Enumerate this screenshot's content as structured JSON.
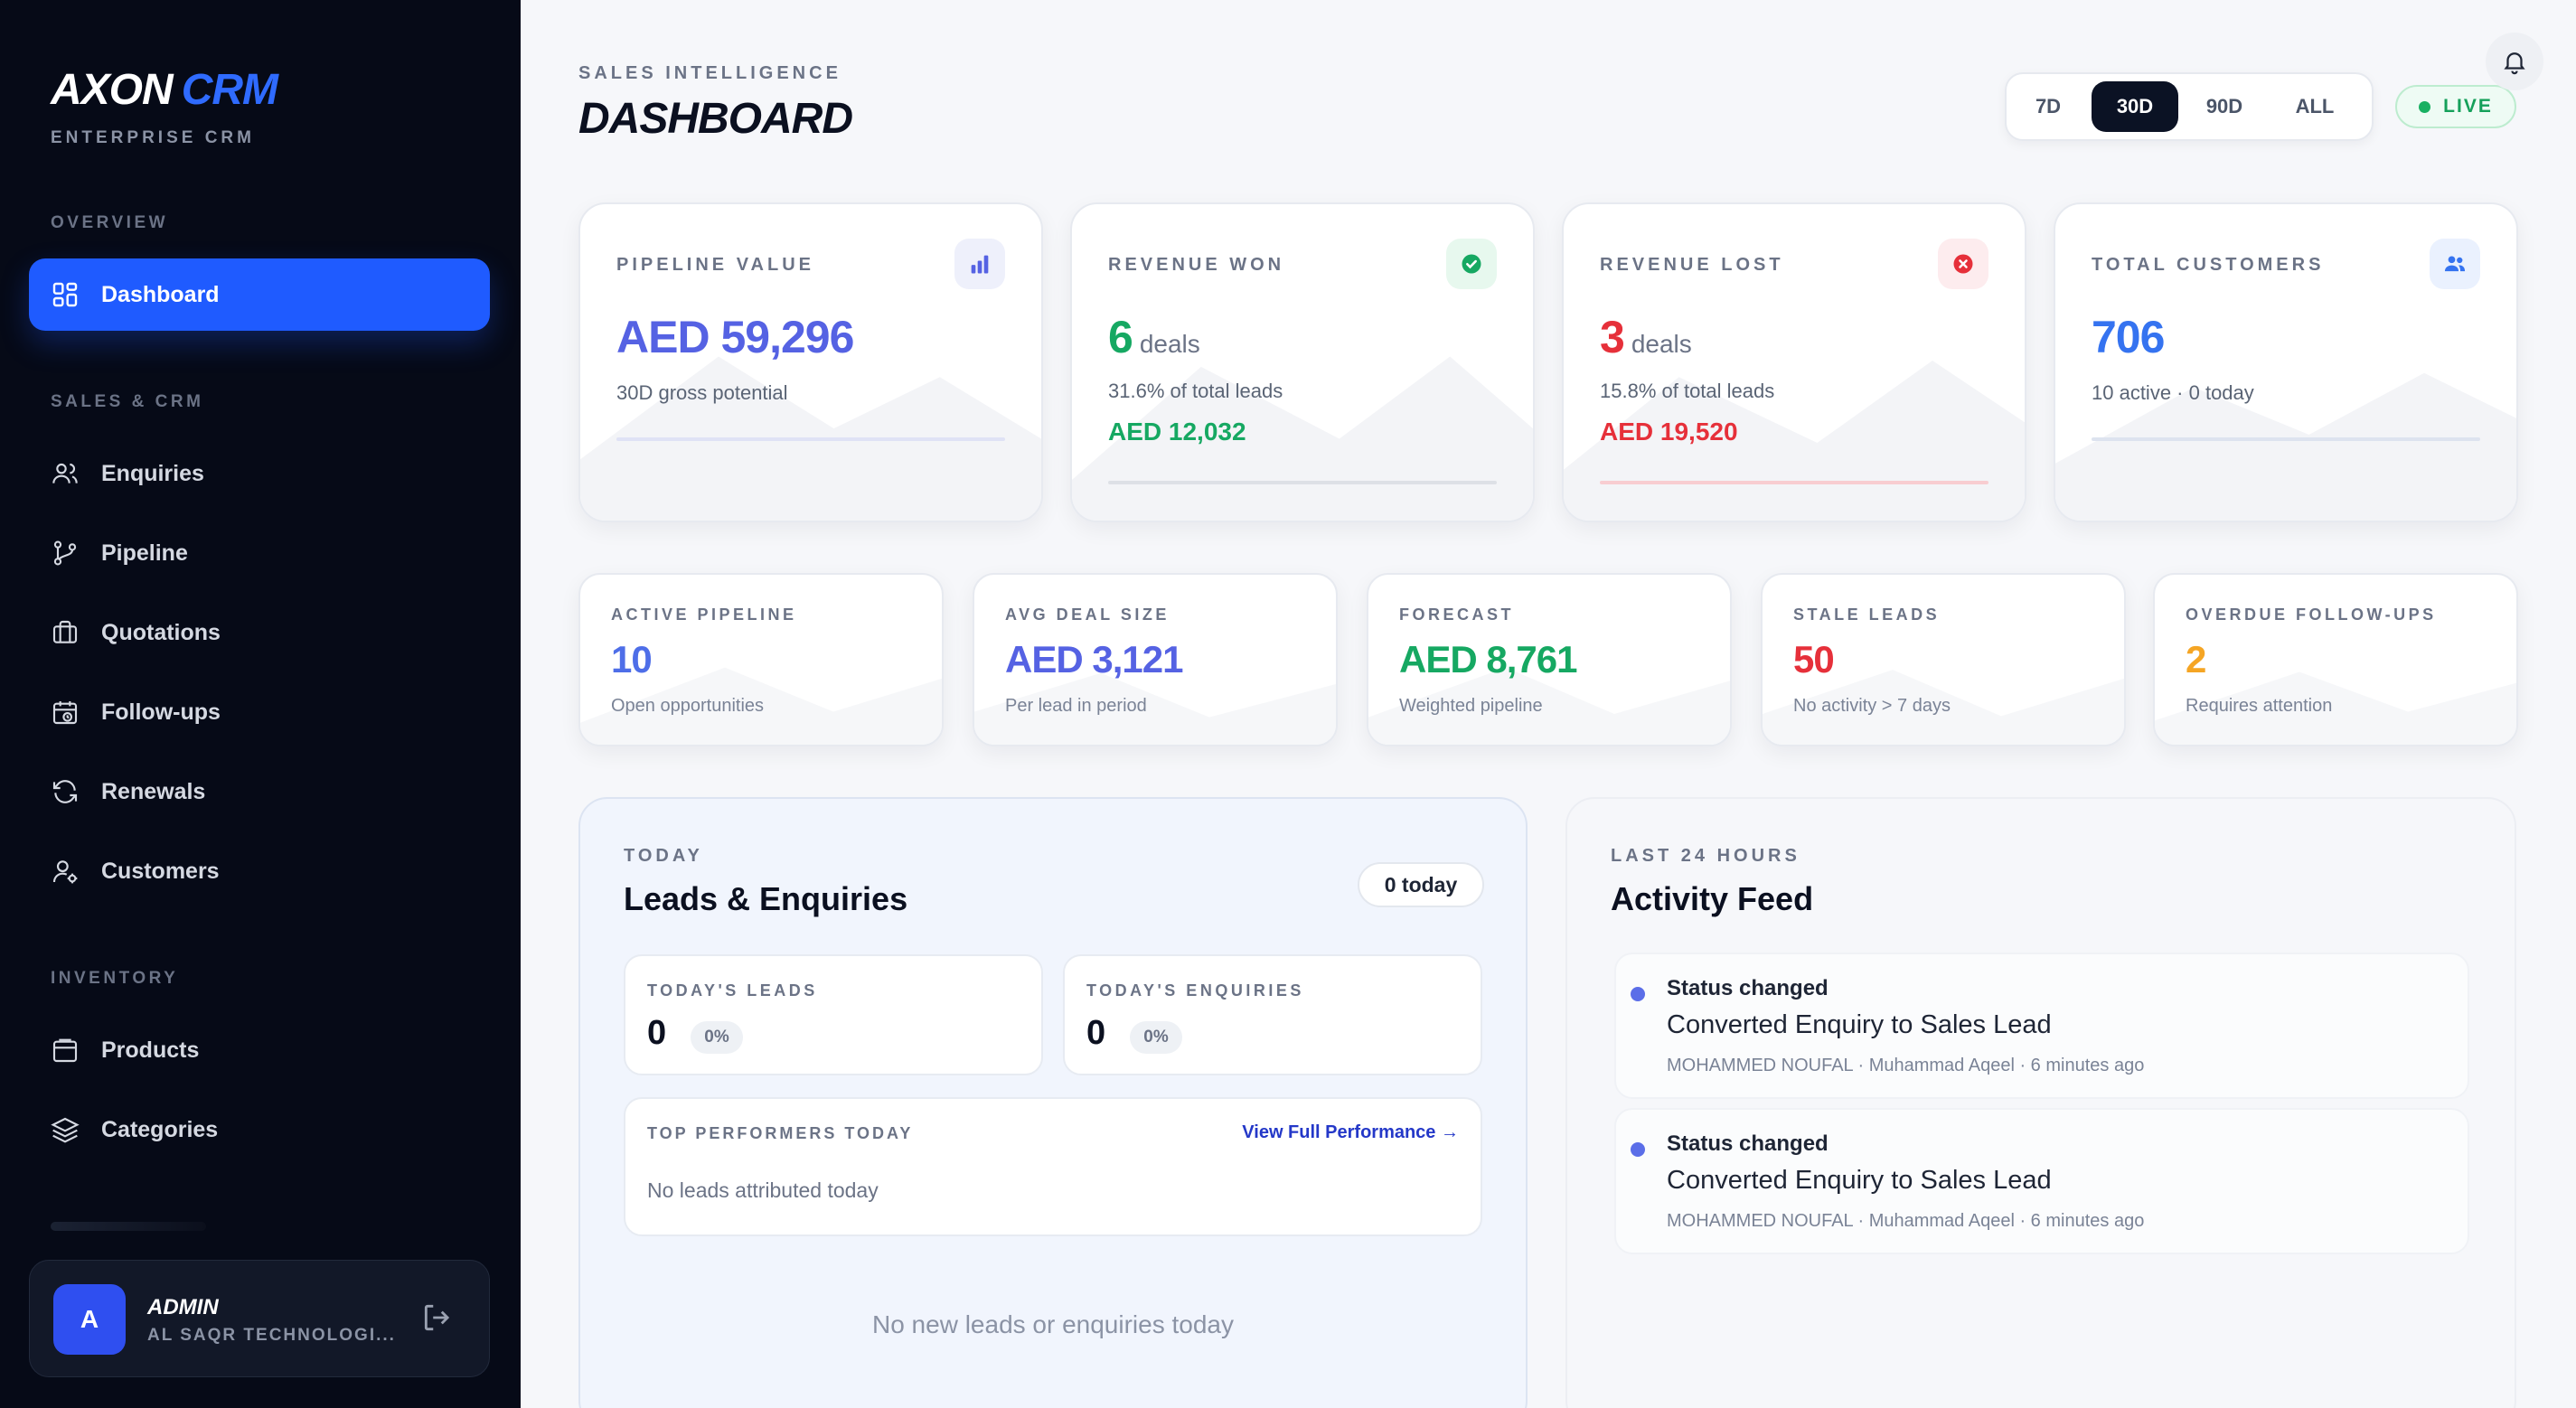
{
  "brand": {
    "name": "AXON",
    "accent": "CRM",
    "subtitle": "ENTERPRISE CRM"
  },
  "sidebar": {
    "sections": {
      "overview": "OVERVIEW",
      "sales": "SALES & CRM",
      "inventory": "INVENTORY"
    },
    "items": [
      {
        "label": "Dashboard",
        "icon": "dashboard-icon",
        "active": true
      },
      {
        "label": "Enquiries",
        "icon": "users-icon"
      },
      {
        "label": "Pipeline",
        "icon": "branch-icon"
      },
      {
        "label": "Quotations",
        "icon": "briefcase-icon"
      },
      {
        "label": "Follow-ups",
        "icon": "calendar-clock-icon"
      },
      {
        "label": "Renewals",
        "icon": "refresh-icon"
      },
      {
        "label": "Customers",
        "icon": "user-gear-icon"
      },
      {
        "label": "Products",
        "icon": "box-icon"
      },
      {
        "label": "Categories",
        "icon": "layers-icon"
      }
    ],
    "user": {
      "initial": "A",
      "name": "ADMIN",
      "org": "AL SAQR TECHNOLOGI..."
    }
  },
  "header": {
    "eyebrow": "SALES INTELLIGENCE",
    "title": "DASHBOARD",
    "ranges": [
      "7D",
      "30D",
      "90D",
      "ALL"
    ],
    "selected_range": "30D",
    "live_label": "LIVE"
  },
  "colors": {
    "accent": "#1f5bff",
    "purple": "#5562e3",
    "green": "#16a862",
    "red": "#e6303a",
    "blue": "#3573f0",
    "orange": "#f5a524",
    "sidebar_bg": "#060a17"
  },
  "kpis": [
    {
      "label": "PIPELINE VALUE",
      "value": "AED 59,296",
      "sub": "30D gross potential",
      "icon": "bar-chart-icon"
    },
    {
      "label": "REVENUE WON",
      "value": "6",
      "unit": "deals",
      "sub": "31.6% of total leads",
      "amount": "AED 12,032",
      "icon": "check-circle-icon"
    },
    {
      "label": "REVENUE LOST",
      "value": "3",
      "unit": "deals",
      "sub": "15.8% of total leads",
      "amount": "AED 19,520",
      "icon": "x-circle-icon"
    },
    {
      "label": "TOTAL CUSTOMERS",
      "value": "706",
      "sub": "10 active · 0 today",
      "icon": "people-icon"
    }
  ],
  "stats": [
    {
      "label": "ACTIVE PIPELINE",
      "value": "10",
      "sub": "Open opportunities"
    },
    {
      "label": "AVG DEAL SIZE",
      "value": "AED 3,121",
      "sub": "Per lead in period"
    },
    {
      "label": "FORECAST",
      "value": "AED 8,761",
      "sub": "Weighted pipeline"
    },
    {
      "label": "STALE LEADS",
      "value": "50",
      "sub": "No activity > 7 days"
    },
    {
      "label": "OVERDUE FOLLOW-UPS",
      "value": "2",
      "sub": "Requires attention"
    }
  ],
  "leads": {
    "eyebrow": "TODAY",
    "title": "Leads & Enquiries",
    "pill": "0 today",
    "leads_label": "TODAY'S LEADS",
    "leads_value": "0",
    "leads_pct": "0%",
    "enquiries_label": "TODAY'S ENQUIRIES",
    "enquiries_value": "0",
    "enquiries_pct": "0%",
    "performers_label": "TOP PERFORMERS TODAY",
    "performers_link": "View Full Performance →",
    "performers_empty": "No leads attributed today",
    "empty": "No new leads or enquiries today"
  },
  "activity": {
    "eyebrow": "LAST 24 HOURS",
    "title": "Activity Feed",
    "items": [
      {
        "type": "Status changed",
        "detail": "Converted Enquiry to Sales Lead",
        "meta": "MOHAMMED NOUFAL · Muhammad Aqeel · 6 minutes ago"
      },
      {
        "type": "Status changed",
        "detail": "Converted Enquiry to Sales Lead",
        "meta": "MOHAMMED NOUFAL · Muhammad Aqeel · 6 minutes ago"
      }
    ]
  }
}
